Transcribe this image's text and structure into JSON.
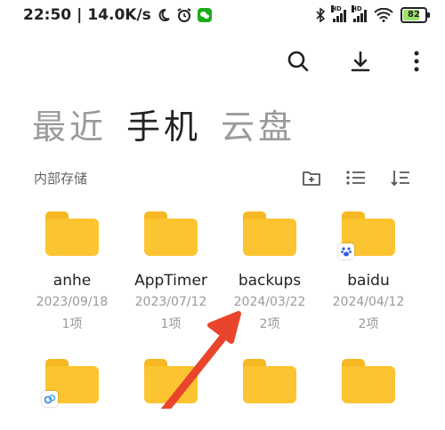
{
  "status_bar": {
    "time": "22:50",
    "net_speed": "14.0K/s",
    "battery": "82",
    "signal_label": "HD"
  },
  "toolbar": {
    "icons": [
      "search-icon",
      "download-icon",
      "more-icon"
    ]
  },
  "tabs": [
    {
      "label": "最近",
      "active": false
    },
    {
      "label": "手机",
      "active": true
    },
    {
      "label": "云盘",
      "active": false
    }
  ],
  "location": {
    "label": "内部存储"
  },
  "folders": [
    {
      "name": "anhe",
      "date": "2023/09/18",
      "count": "1项",
      "badge": ""
    },
    {
      "name": "AppTimer",
      "date": "2023/07/12",
      "count": "1项",
      "badge": ""
    },
    {
      "name": "backups",
      "date": "2024/03/22",
      "count": "2项",
      "badge": ""
    },
    {
      "name": "baidu",
      "date": "2024/04/12",
      "count": "2项",
      "badge": "baidu-paw-icon"
    },
    {
      "name": "",
      "date": "",
      "count": "",
      "badge": "cloud-app-icon"
    },
    {
      "name": "",
      "date": "",
      "count": "",
      "badge": ""
    },
    {
      "name": "",
      "date": "",
      "count": "",
      "badge": ""
    },
    {
      "name": "",
      "date": "",
      "count": "",
      "badge": ""
    }
  ],
  "colors": {
    "folder": "#fcc431",
    "folder_tab": "#f7b824",
    "arrow": "#e8452c",
    "tab_inactive": "#9a9a9a"
  }
}
